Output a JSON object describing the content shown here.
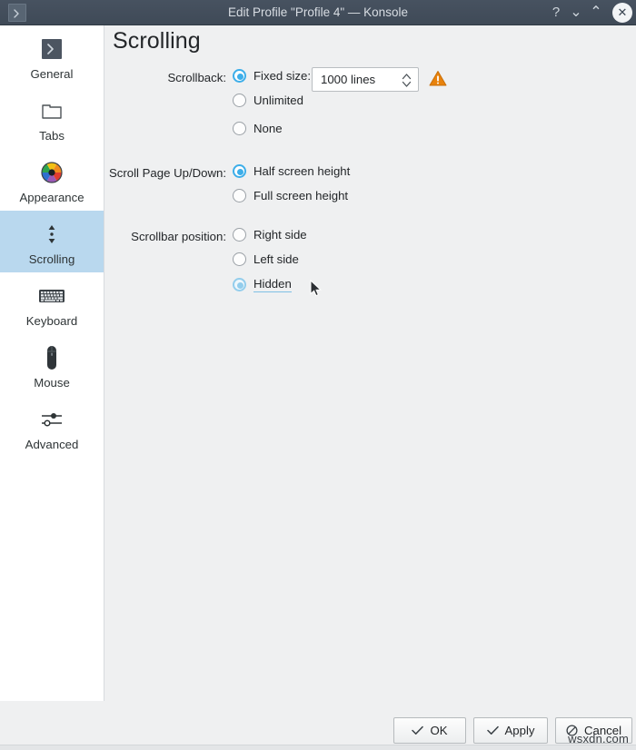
{
  "window": {
    "title": "Edit Profile \"Profile 4\" — Konsole",
    "app_icon": "terminal-prompt-icon",
    "controls": {
      "help": "?",
      "minimize": "⌄",
      "maximize": "⌃",
      "close": "✕"
    }
  },
  "sidebar": {
    "items": [
      {
        "label": "General",
        "icon": "terminal-prompt-icon",
        "selected": false
      },
      {
        "label": "Tabs",
        "icon": "folder-icon",
        "selected": false
      },
      {
        "label": "Appearance",
        "icon": "color-wheel-icon",
        "selected": false
      },
      {
        "label": "Scrolling",
        "icon": "scroll-arrows-icon",
        "selected": true
      },
      {
        "label": "Keyboard",
        "icon": "keyboard-icon",
        "selected": false
      },
      {
        "label": "Mouse",
        "icon": "mouse-icon",
        "selected": false
      },
      {
        "label": "Advanced",
        "icon": "sliders-icon",
        "selected": false
      }
    ]
  },
  "page": {
    "title": "Scrolling",
    "groups": [
      {
        "label": "Scrollback:",
        "options": [
          {
            "label": "Fixed size:",
            "checked": true,
            "hover": false
          },
          {
            "label": "Unlimited",
            "checked": false,
            "hover": false
          },
          {
            "label": "None",
            "checked": false,
            "hover": false
          }
        ]
      },
      {
        "label": "Scroll Page Up/Down:",
        "options": [
          {
            "label": "Half screen height",
            "checked": true,
            "hover": false
          },
          {
            "label": "Full screen height",
            "checked": false,
            "hover": false
          }
        ]
      },
      {
        "label": "Scrollbar position:",
        "options": [
          {
            "label": "Right side",
            "checked": false,
            "hover": false
          },
          {
            "label": "Left side",
            "checked": false,
            "hover": false
          },
          {
            "label": "Hidden",
            "checked": true,
            "hover": true
          }
        ]
      }
    ],
    "spinbox": {
      "value": "1000 lines",
      "icon": "spin-arrows-icon"
    },
    "warning_icon": "warning-triangle-icon"
  },
  "buttons": {
    "ok": "OK",
    "apply": "Apply",
    "cancel": "Cancel"
  },
  "watermark": "wsxdn.com",
  "colors": {
    "titlebar": "#475260",
    "accent": "#3daee9",
    "accent_hover": "#93cdec",
    "selection": "#b9d8ee",
    "content_bg": "#eff0f1",
    "sidebar_bg": "#ffffff",
    "warning": "#e8820c"
  }
}
